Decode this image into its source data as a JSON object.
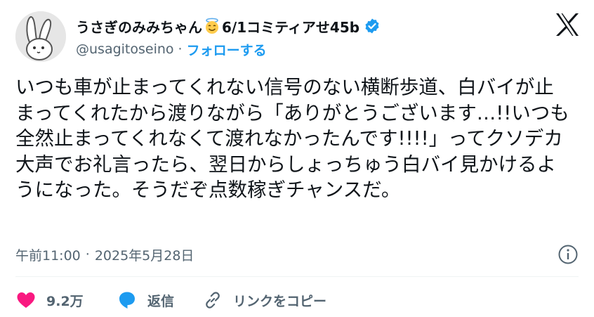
{
  "author": {
    "display_name": "うさぎのみみちゃん",
    "display_name_suffix": "6/1コミティアせ45b",
    "handle": "@usagitoseino",
    "separator": "·",
    "follow_label": "フォローする",
    "halo_emoji_icon": "smiling-face-with-halo-icon",
    "verified_icon": "verified-badge-icon"
  },
  "tweet": {
    "text": "いつも車が止まってくれない信号のない横断歩道、白バイが止まってくれたから渡りながら「ありがとうございます…!!いつも全然止まってくれなくて渡れなかったんです!!!!」ってクソデカ大声でお礼言ったら、翌日からしょっちゅう白バイ見かけるようになった。そうだぞ点数稼ぎチャンスだ。"
  },
  "meta": {
    "time": "午前11:00",
    "separator": "·",
    "date": "2025年5月28日"
  },
  "actions": {
    "like_count": "9.2万",
    "reply_label": "返信",
    "copy_link_label": "リンクをコピー"
  },
  "colors": {
    "accent": "#1d9bf0",
    "like": "#f91880",
    "text": "#0f1419",
    "secondary": "#536471"
  }
}
